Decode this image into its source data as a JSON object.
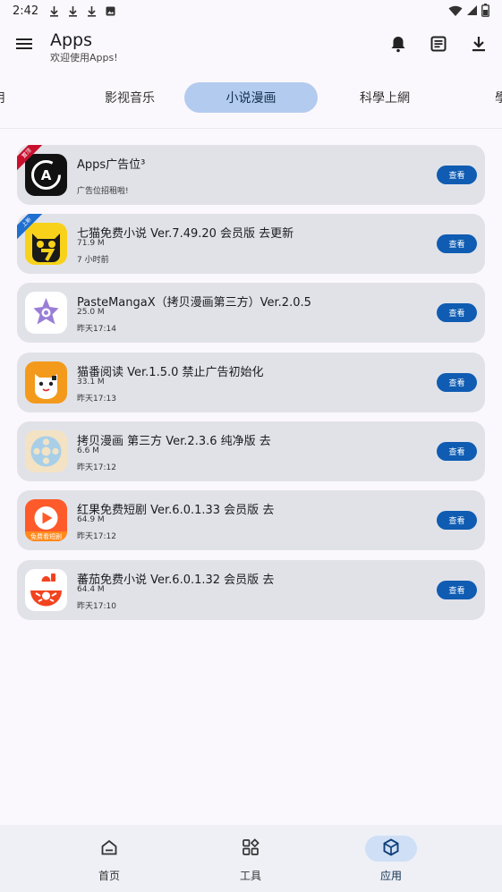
{
  "status_bar": {
    "time": "2:42",
    "icons": [
      "download-icon",
      "download-icon",
      "download-icon",
      "image-icon"
    ],
    "right_icons": [
      "wifi-icon",
      "signal-icon",
      "battery-icon"
    ]
  },
  "app_bar": {
    "title": "Apps",
    "subtitle": "欢迎使用Apps!",
    "actions": [
      "bell-icon",
      "notes-icon",
      "download-icon"
    ]
  },
  "tabs": [
    {
      "label": "用",
      "active": false
    },
    {
      "label": "影视音乐",
      "active": false
    },
    {
      "label": "小说漫画",
      "active": true
    },
    {
      "label": "科學上網",
      "active": false
    },
    {
      "label": "學",
      "active": false
    }
  ],
  "apps": [
    {
      "name": "Apps广告位³",
      "size": "",
      "date": "广告位招租啦!",
      "button": "查看",
      "ribbon": "置顶",
      "ribbon_color": "#c8102e",
      "icon": "apps-ad-icon"
    },
    {
      "name": "七猫免费小说 Ver.7.49.20 会员版 去更新",
      "size": "71.9 M",
      "date": "7 小时前",
      "button": "查看",
      "ribbon": "上新",
      "ribbon_color": "#1f6fd0",
      "icon": "qimao-cat-icon"
    },
    {
      "name": "PasteMangaX（拷贝漫画第三方）Ver.2.0.5",
      "size": "25.0 M",
      "date": "昨天17:14",
      "button": "查看",
      "ribbon": "",
      "ribbon_color": "",
      "icon": "pastemanga-star-icon"
    },
    {
      "name": "猫番阅读 Ver.1.5.0 禁止广告初始化",
      "size": "33.1 M",
      "date": "昨天17:13",
      "button": "查看",
      "ribbon": "",
      "ribbon_color": "",
      "icon": "maofan-cat-icon"
    },
    {
      "name": "拷贝漫画 第三方 Ver.2.3.6 纯净版 去",
      "size": "6.6 M",
      "date": "昨天17:12",
      "button": "查看",
      "ribbon": "",
      "ribbon_color": "",
      "icon": "copymanga-reel-icon"
    },
    {
      "name": "红果免费短剧 Ver.6.0.1.33 会员版 去",
      "size": "64.9 M",
      "date": "昨天17:12",
      "button": "查看",
      "ribbon": "",
      "ribbon_color": "",
      "icon": "hongguo-play-icon",
      "icon_caption": "免费看短剧"
    },
    {
      "name": "蕃茄免费小说 Ver.6.0.1.32 会员版 去",
      "size": "64.4 M",
      "date": "昨天17:10",
      "button": "查看",
      "ribbon": "",
      "ribbon_color": "",
      "icon": "fanqie-tomato-icon"
    }
  ],
  "bottom_nav": [
    {
      "label": "首页",
      "icon": "home-icon",
      "active": false
    },
    {
      "label": "工具",
      "icon": "tools-grid-icon",
      "active": false
    },
    {
      "label": "应用",
      "icon": "apps-cube-icon",
      "active": true
    }
  ],
  "colors": {
    "accent": "#0f5cb2",
    "tab_active": "#b3cbef",
    "card_bg": "#e1e2e8",
    "nav_bg": "#eef0f6"
  }
}
